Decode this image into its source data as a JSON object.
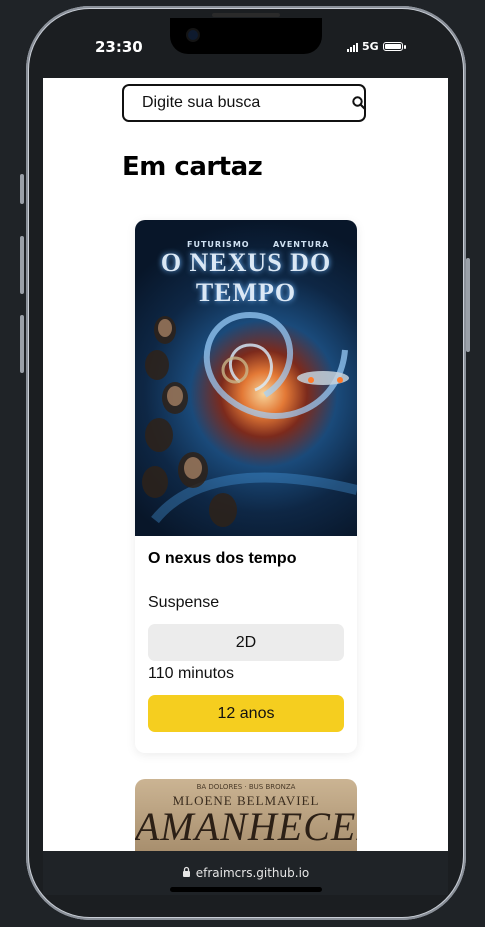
{
  "status": {
    "time": "23:30",
    "network": "5G"
  },
  "search": {
    "placeholder": "Digite sua busca"
  },
  "page": {
    "heading": "Em cartaz"
  },
  "movies": [
    {
      "title": "O nexus dos tempo",
      "genre": "Suspense",
      "format": "2D",
      "duration": "110 minutos",
      "rating": "12 anos",
      "poster": {
        "kicker_left": "FUTURISMO",
        "kicker_right": "AVENTURA",
        "title": "O NEXUS DO TEMPO"
      }
    },
    {
      "poster": {
        "kicker": "BA DOLORES · BUS BRONZA",
        "names": "MLOENE BELMAVIEL",
        "title": "AMANHECER"
      }
    }
  ],
  "browser": {
    "url": "efraimcrs.github.io"
  },
  "colors": {
    "rating_badge": "#f5ce1f",
    "format_badge": "#ececec",
    "frame": "#1f2327"
  }
}
